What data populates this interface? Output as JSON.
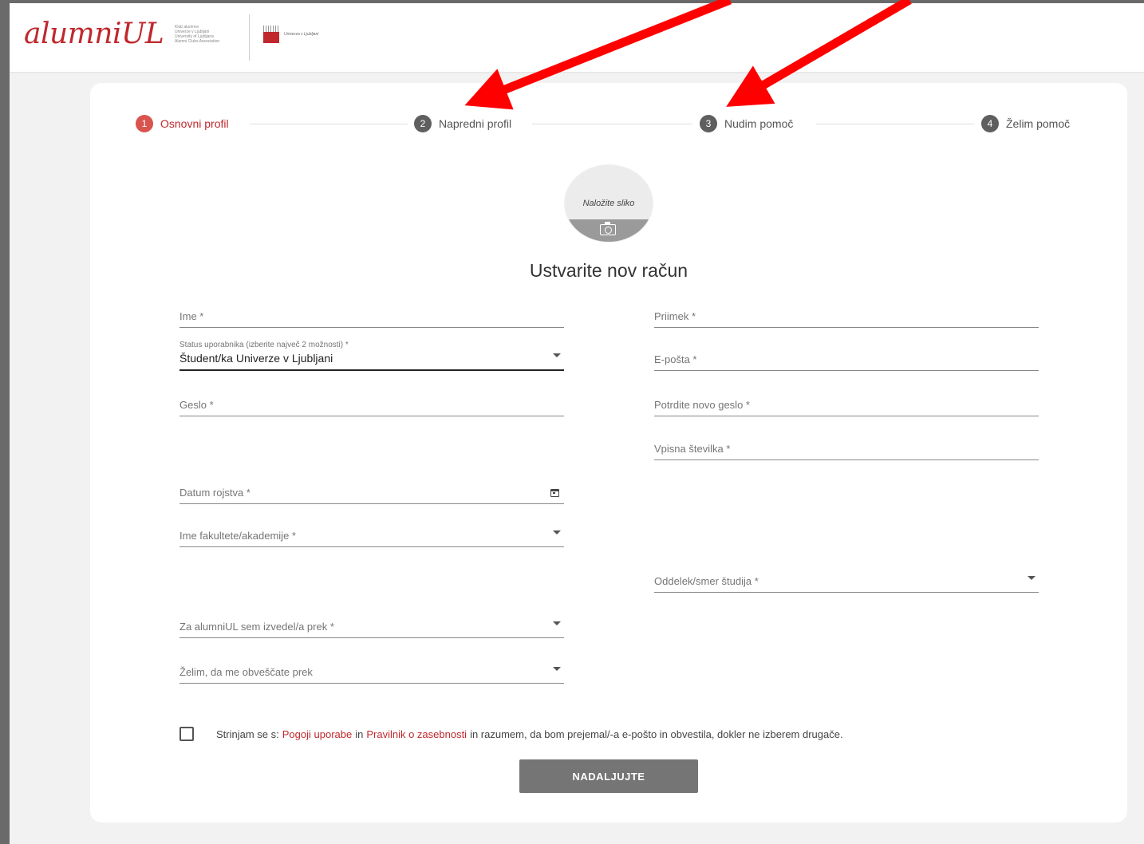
{
  "header": {
    "logo_text": "alumniUL",
    "logo_small_lines": [
      "Klub alumnov",
      "Univerze v Ljubljani",
      "University of Ljubljana",
      "Alumni Clubs Association"
    ],
    "university_name": "Univerza v Ljubljani"
  },
  "stepper": {
    "steps": [
      {
        "num": "1",
        "label": "Osnovni profil",
        "active": true
      },
      {
        "num": "2",
        "label": "Napredni profil",
        "active": false
      },
      {
        "num": "3",
        "label": "Nudim pomoč",
        "active": false
      },
      {
        "num": "4",
        "label": "Želim pomoč",
        "active": false
      }
    ]
  },
  "avatar": {
    "label": "Naložite sliko",
    "icon": "camera-icon"
  },
  "form": {
    "title": "Ustvarite nov račun",
    "first_name": "Ime *",
    "last_name": "Priimek *",
    "status_label": "Status uporabnika (izberite največ 2 možnosti) *",
    "status_value": "Študent/ka Univerze v Ljubljani",
    "email": "E-pošta *",
    "password": "Geslo *",
    "confirm_password": "Potrdite novo geslo *",
    "enrollment_number": "Vpisna številka *",
    "birth_date": "Datum rojstva *",
    "faculty": "Ime fakultete/akademije *",
    "department": "Oddelek/smer študija *",
    "heard_via": "Za alumniUL sem izvedel/a prek *",
    "notify_via": "Želim, da me obveščate prek"
  },
  "consent": {
    "prefix": "Strinjam se s:",
    "terms_link": "Pogoji uporabe",
    "and": "in",
    "privacy_link": "Pravilnik o zasebnosti",
    "suffix": "in razumem, da bom prejemal/-a e-pošto in obvestila, dokler ne izberem drugače."
  },
  "submit_label": "NADALJUJTE",
  "colors": {
    "accent": "#c0282d",
    "arrow": "#ff0000",
    "button": "#757575"
  }
}
